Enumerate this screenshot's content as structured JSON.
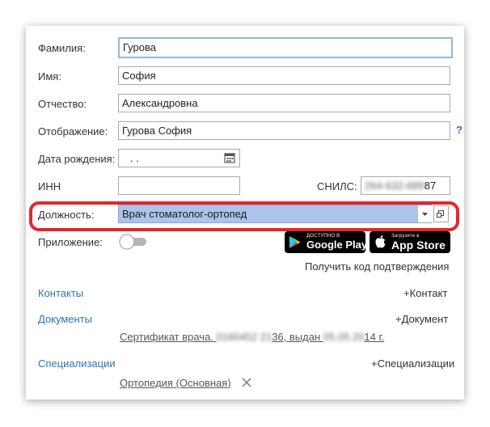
{
  "form": {
    "surname": {
      "label": "Фамилия:",
      "value": "Гурова"
    },
    "name": {
      "label": "Имя:",
      "value": "София"
    },
    "patronymic": {
      "label": "Отчество:",
      "value": "Александровна"
    },
    "display": {
      "label": "Отображение:",
      "value": "Гурова София",
      "help": "?"
    },
    "birthdate": {
      "label": "Дата рождения:",
      "value": ". ."
    },
    "inn": {
      "label": "ИНН",
      "value": ""
    },
    "snils": {
      "label": "СНИЛС:",
      "value_hidden": "264-632-689",
      "value_tail": "87"
    },
    "position": {
      "label": "Должность:",
      "value": "Врач стоматолог-ортопед"
    },
    "app": {
      "label": "Приложение:",
      "toggle_on": false
    }
  },
  "stores": {
    "google": {
      "small": "ДОСТУПНО В",
      "big": "Google Play"
    },
    "apple": {
      "small": "Загрузите в",
      "big": "App Store"
    }
  },
  "confirm_code": "Получить код подтверждения",
  "sections": {
    "contacts": {
      "title": "Контакты",
      "add": "+Контакт"
    },
    "documents": {
      "title": "Документы",
      "add": "+Документ",
      "item_a": "Сертификат врача. ",
      "item_hidden1": "0160452 21",
      "item_b": "36, выдан ",
      "item_hidden2": "05.05.20",
      "item_c": "14 г."
    },
    "specializations": {
      "title": "Специализации",
      "add": "+Специализации",
      "item": "Ортопедия (Основная)"
    }
  },
  "colors": {
    "highlight": "#e5252a",
    "link": "#2e74b5",
    "selected": "#aac4ea"
  }
}
